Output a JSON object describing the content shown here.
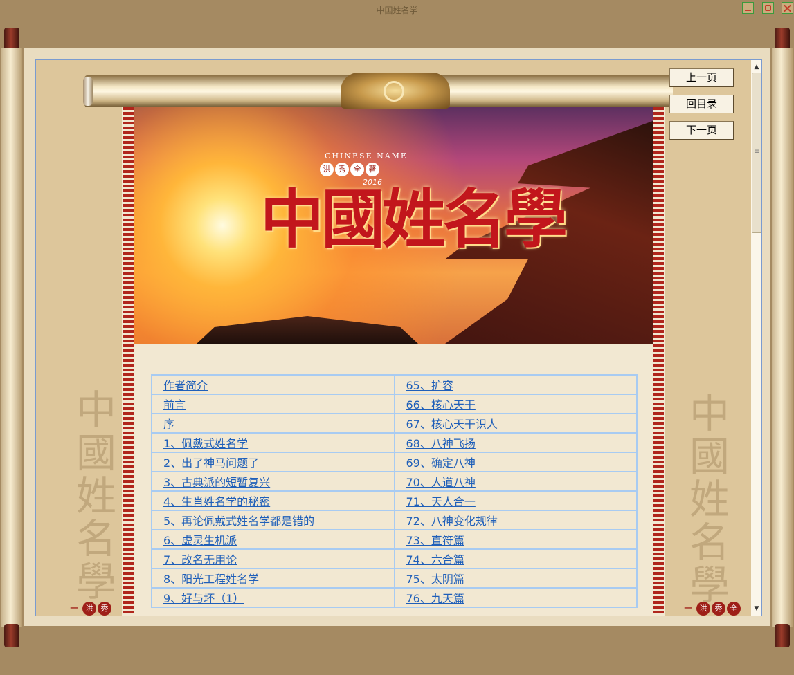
{
  "window": {
    "title": "中国姓名学"
  },
  "banner": {
    "subtitle": "CHINESE NAME",
    "authors": [
      "洪",
      "秀",
      "全",
      "著"
    ],
    "year": "2016",
    "title": "中國姓名學"
  },
  "nav": {
    "prev": "上一页",
    "toc": "回目录",
    "next": "下一页"
  },
  "decor": {
    "left_calligraphy": "中國姓名學",
    "right_calligraphy": "中國姓名學",
    "left_stamps": [
      "一",
      "洪",
      "秀"
    ],
    "right_stamps": [
      "一",
      "洪",
      "秀",
      "全"
    ]
  },
  "toc": {
    "rows": [
      [
        "作者简介",
        "65、扩容"
      ],
      [
        "前言",
        "66、核心天干"
      ],
      [
        "序",
        "67、核心天干识人"
      ],
      [
        "1、佩戴式姓名学",
        "68、八神飞扬"
      ],
      [
        "2、出了神马问题了",
        "69、确定八神"
      ],
      [
        "3、古典派的短暂复兴",
        "70、人道八神"
      ],
      [
        "4、生肖姓名学的秘密",
        "71、天人合一"
      ],
      [
        "5、再论佩戴式姓名学都是错的",
        "72、八神变化规律"
      ],
      [
        "6、虚灵生机派",
        "73、直符篇"
      ],
      [
        "7、改名无用论",
        "74、六合篇"
      ],
      [
        "8、阳光工程姓名学",
        "75、太阴篇"
      ],
      [
        "9、好与坏（1）",
        "76、九天篇"
      ]
    ]
  },
  "colors": {
    "frame_bg": "#a58a62",
    "page_bg": "#f2e8d2",
    "link": "#1f5fb9",
    "table_border": "#a8cbf2",
    "fret": "#b0261c"
  }
}
